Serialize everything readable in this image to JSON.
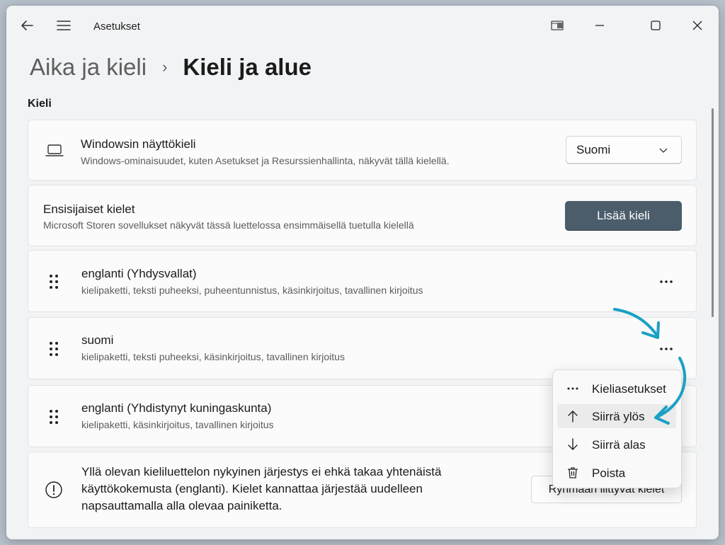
{
  "app": {
    "title": "Asetukset"
  },
  "breadcrumb": {
    "parent": "Aika ja kieli",
    "separator": "›",
    "current": "Kieli ja alue"
  },
  "section": {
    "label": "Kieli"
  },
  "display_language": {
    "title": "Windowsin näyttökieli",
    "description": "Windows-ominaisuudet, kuten Asetukset ja Resurssienhallinta, näkyvät tällä kielellä.",
    "selected": "Suomi"
  },
  "preferred": {
    "title": "Ensisijaiset kielet",
    "description": "Microsoft Storen sovellukset näkyvät tässä luettelossa ensimmäisellä tuetulla kielellä",
    "add_button": "Lisää kieli"
  },
  "languages": [
    {
      "name": "englanti (Yhdysvallat)",
      "features": "kielipaketti, teksti puheeksi, puheentunnistus, käsinkirjoitus, tavallinen kirjoitus"
    },
    {
      "name": "suomi",
      "features": "kielipaketti, teksti puheeksi, käsinkirjoitus, tavallinen kirjoitus"
    },
    {
      "name": "englanti (Yhdistynyt kuningaskunta)",
      "features": "kielipaketti, käsinkirjoitus, tavallinen kirjoitus"
    }
  ],
  "warning": {
    "text": "Yllä olevan kieliluettelon nykyinen järjestys ei ehkä takaa yhtenäistä käyttökokemusta (englanti). Kielet kannattaa järjestää uudelleen napsauttamalla alla olevaa painiketta.",
    "button": "Ryhmään liittyvät kielet"
  },
  "context_menu": {
    "items": [
      {
        "label": "Kieliasetukset",
        "icon": "more-icon"
      },
      {
        "label": "Siirrä ylös",
        "icon": "arrow-up-icon"
      },
      {
        "label": "Siirrä alas",
        "icon": "arrow-down-icon"
      },
      {
        "label": "Poista",
        "icon": "trash-icon"
      }
    ],
    "highlighted_index": 1
  },
  "colors": {
    "accent_button": "#4b5d6b",
    "annotation_arrow": "#1aa0c4",
    "window_bg": "#f2f3f5",
    "card_bg": "#fbfbfb"
  }
}
